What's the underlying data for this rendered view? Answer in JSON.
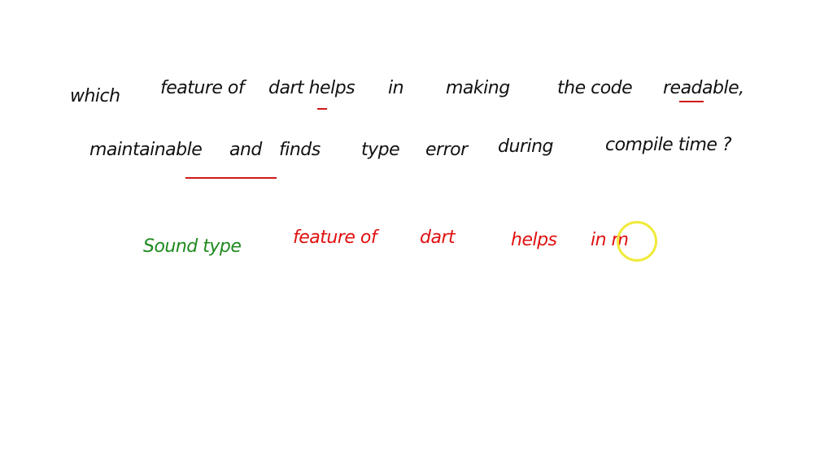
{
  "question": {
    "line1": [
      "which",
      "feature of",
      "dart helps",
      "in",
      "making",
      "the code",
      "readable,"
    ],
    "line2": [
      "maintainable",
      "and",
      "finds",
      "type",
      "error",
      "during",
      "compile time ?"
    ]
  },
  "answer": {
    "green_text": "Sound type",
    "red_words": [
      "feature of",
      "dart",
      "helps",
      "in m"
    ]
  },
  "colors": {
    "question_ink": "#111111",
    "answer_green": "#1e8a1e",
    "answer_red": "#e01010",
    "underline": "#d01818",
    "cursor_highlight": "#f0ea3a"
  }
}
